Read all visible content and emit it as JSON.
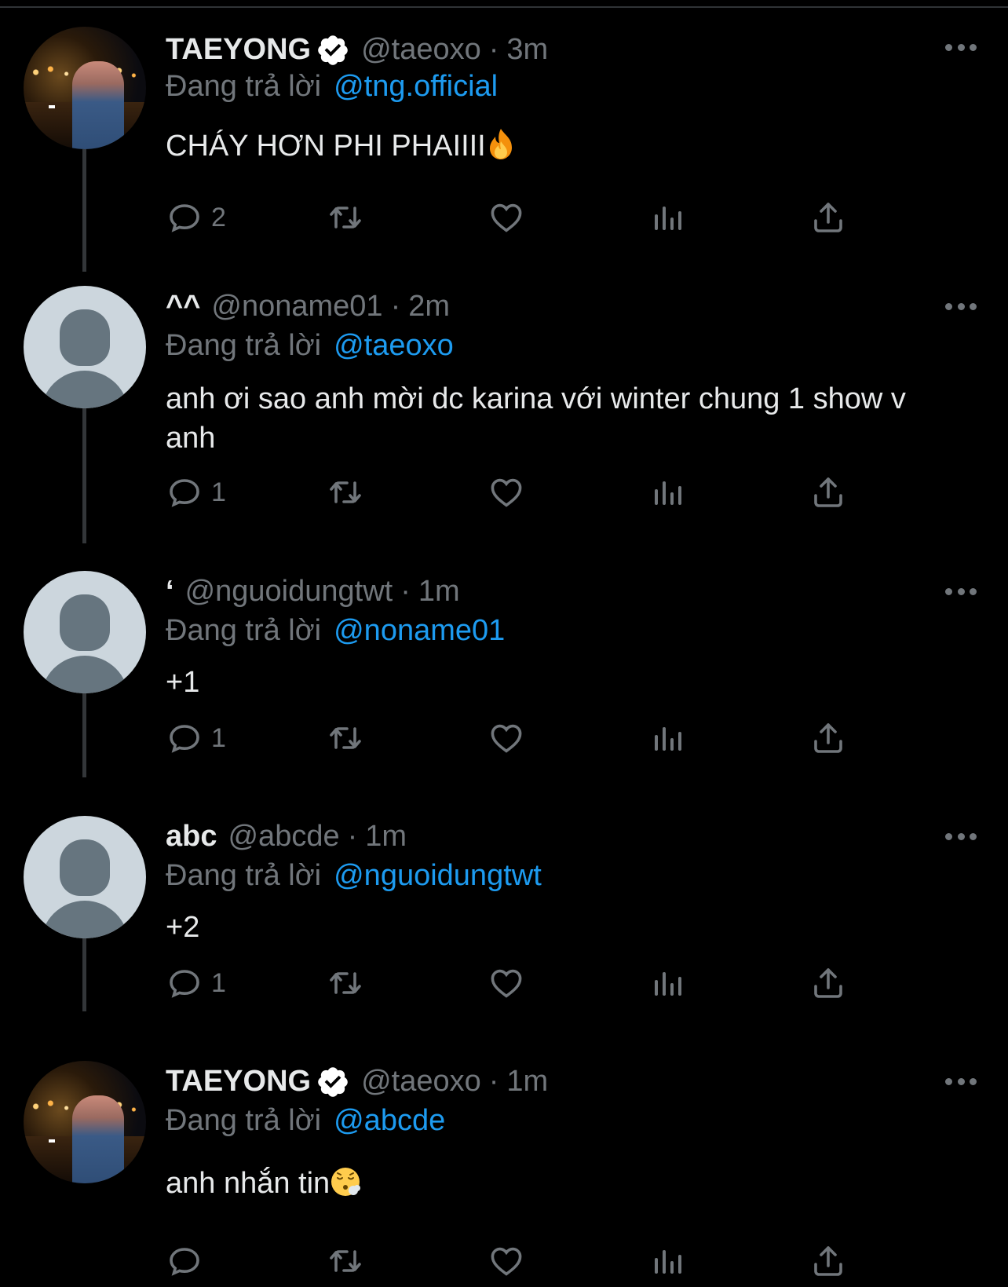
{
  "theme": {
    "background": "#000000",
    "text_primary": "#e7e9ea",
    "text_secondary": "#71767b",
    "link": "#1d9bf0",
    "thread_line": "#333639",
    "default_avatar_bg": "#ccd6dd",
    "default_avatar_fg": "#66757f",
    "verified_badge": "#ffffff"
  },
  "reply_prefix": "Đang trả lời",
  "more_label": "…",
  "tweets": [
    {
      "display_name": "TAEYONG",
      "verified": true,
      "handle": "@taeoxo",
      "separator": "·",
      "time": "3m",
      "replying_to": "@tng.official",
      "text": "CHÁY HƠN PHI PHAIIII",
      "emoji": "fire-emoji",
      "avatar": "photo",
      "reply_count": "2"
    },
    {
      "display_name": "^^",
      "verified": false,
      "handle": "@noname01",
      "separator": "·",
      "time": "2m",
      "replying_to": "@taeoxo",
      "text": "anh ơi sao anh mời dc karina với winter chung 1 show v anh",
      "avatar": "default",
      "reply_count": "1"
    },
    {
      "display_name": "‘",
      "verified": false,
      "handle": "@nguoidungtwt",
      "separator": "·",
      "time": "1m",
      "replying_to": "@noname01",
      "text": "+1",
      "avatar": "default",
      "reply_count": "1"
    },
    {
      "display_name": "abc",
      "verified": false,
      "handle": "@abcde",
      "separator": "·",
      "time": "1m",
      "replying_to": "@nguoidungtwt",
      "text": "+2",
      "avatar": "default",
      "reply_count": "1"
    },
    {
      "display_name": "TAEYONG",
      "verified": true,
      "handle": "@taeoxo",
      "separator": "·",
      "time": "1m",
      "replying_to": "@abcde",
      "text": "anh nhắn tin",
      "emoji": "face-exhaling-emoji",
      "avatar": "photo",
      "reply_count": ""
    }
  ],
  "icons": {
    "reply": "reply-bubble-icon",
    "retweet": "retweet-icon",
    "like": "heart-icon",
    "views": "views-chart-icon",
    "share": "share-icon",
    "more": "more-dots-icon",
    "verified": "verified-badge-icon"
  }
}
